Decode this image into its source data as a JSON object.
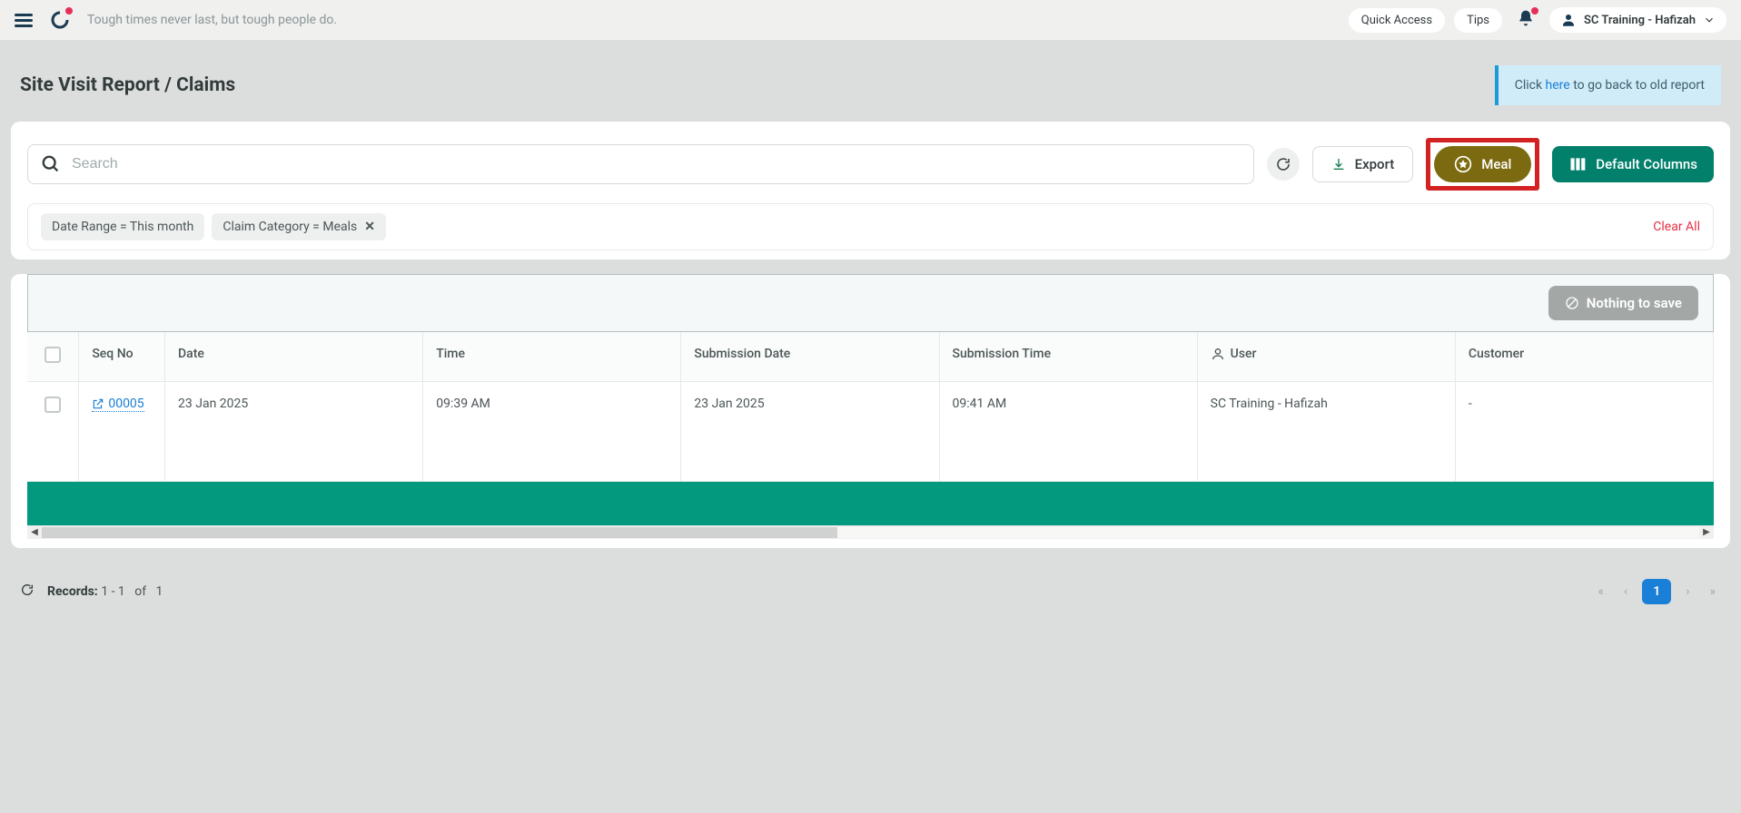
{
  "topbar": {
    "tagline": "Tough times never last, but tough people do.",
    "quick_access": "Quick Access",
    "tips": "Tips",
    "user_name": "SC Training - Hafizah"
  },
  "page_title": "Site Visit Report / Claims",
  "notice": {
    "prefix": "Click ",
    "link": "here",
    "suffix": " to go back to old report"
  },
  "search": {
    "placeholder": "Search"
  },
  "buttons": {
    "export": "Export",
    "meal": "Meal",
    "default_columns": "Default Columns",
    "nothing_to_save": "Nothing to save"
  },
  "filters": {
    "chips": [
      {
        "label": "Date Range  =  This month",
        "closable": false
      },
      {
        "label": "Claim Category  =  Meals",
        "closable": true
      }
    ],
    "clear_all": "Clear All"
  },
  "table": {
    "headers": {
      "seq": "Seq No",
      "date": "Date",
      "time": "Time",
      "submission_date": "Submission Date",
      "submission_time": "Submission Time",
      "user": "User",
      "customer": "Customer"
    },
    "rows": [
      {
        "seq": "00005",
        "date": "23 Jan 2025",
        "time": "09:39 AM",
        "submission_date": "23 Jan 2025",
        "submission_time": "09:41 AM",
        "user": "SC Training - Hafizah",
        "customer": "-"
      }
    ]
  },
  "footer": {
    "records_label": "Records:",
    "range": "1 - 1",
    "of": "of",
    "total": "1"
  },
  "pager": {
    "current": "1"
  }
}
